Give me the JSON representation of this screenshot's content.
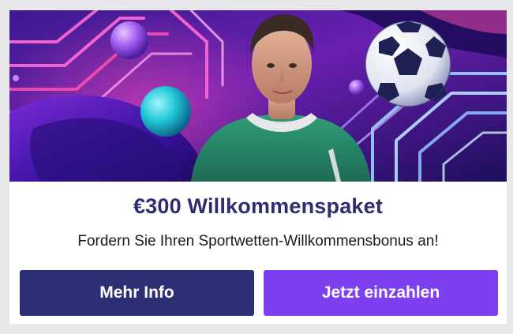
{
  "promo": {
    "title": "€300 Willkommenspaket",
    "subtitle": "Fordern Sie Ihren Sportwetten-Willkommensbonus an!",
    "more_info_label": "Mehr Info",
    "deposit_label": "Jetzt einzahlen"
  },
  "colors": {
    "title": "#2d2d6f",
    "more_info_button": "#2c2f73",
    "deposit_button": "#7d3ff0",
    "hero_background": "#2a0f66"
  },
  "hero_image": {
    "icons": [
      "football-icon",
      "player-figure",
      "neon-lines",
      "decorative-spheres"
    ]
  }
}
